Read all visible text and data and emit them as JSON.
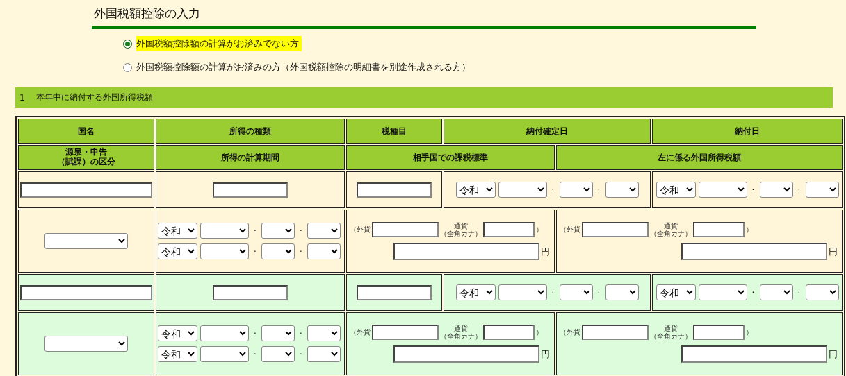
{
  "title": "外国税額控除の入力",
  "options": [
    {
      "label": "外国税額控除額の計算がお済みでない方",
      "selected": true,
      "highlighted": true
    },
    {
      "label": "外国税額控除額の計算がお済みの方（外国税額控除の明細書を別途作成される方）",
      "selected": false,
      "highlighted": false
    }
  ],
  "section": {
    "number": "1",
    "title": "本年中に納付する外国所得税額"
  },
  "header_row_1": [
    "国名",
    "所得の種類",
    "税種目",
    "納付確定日",
    "納付日"
  ],
  "header_row_2_first_cell": [
    "源泉・申告",
    "（賦課）の区分"
  ],
  "header_row_2": [
    "所得の計算期間",
    "相手国での課税標準",
    "左に係る外国所得税額"
  ],
  "entries": [
    {
      "confirm_date": {
        "era": "令和",
        "separators": [
          "·",
          "·"
        ]
      },
      "payment_date": {
        "era": "令和",
        "separators": [
          "·",
          "·"
        ]
      },
      "period_start": {
        "era": "令和",
        "separators": [
          "·",
          "·"
        ]
      },
      "period_end": {
        "era": "令和",
        "separators": [
          "·",
          "·"
        ]
      },
      "tax_base": {
        "foreign_label": "（外貨",
        "currency_label": "通貨",
        "kana_label": "（全角カナ）",
        "close": "）",
        "yen": "円"
      },
      "tax_amount": {
        "foreign_label": "（外貨",
        "currency_label": "通貨",
        "kana_label": "（全角カナ）",
        "close": "）",
        "yen": "円"
      }
    },
    {
      "confirm_date": {
        "era": "令和",
        "separators": [
          "·",
          "·"
        ]
      },
      "payment_date": {
        "era": "令和",
        "separators": [
          "·",
          "·"
        ]
      },
      "period_start": {
        "era": "令和",
        "separators": [
          "·",
          "·"
        ]
      },
      "period_end": {
        "era": "令和",
        "separators": [
          "·",
          "·"
        ]
      },
      "tax_base": {
        "foreign_label": "（外貨",
        "currency_label": "通貨",
        "kana_label": "（全角カナ）",
        "close": "）",
        "yen": "円"
      },
      "tax_amount": {
        "foreign_label": "（外貨",
        "currency_label": "通貨",
        "kana_label": "（全角カナ）",
        "close": "）",
        "yen": "円"
      }
    }
  ]
}
